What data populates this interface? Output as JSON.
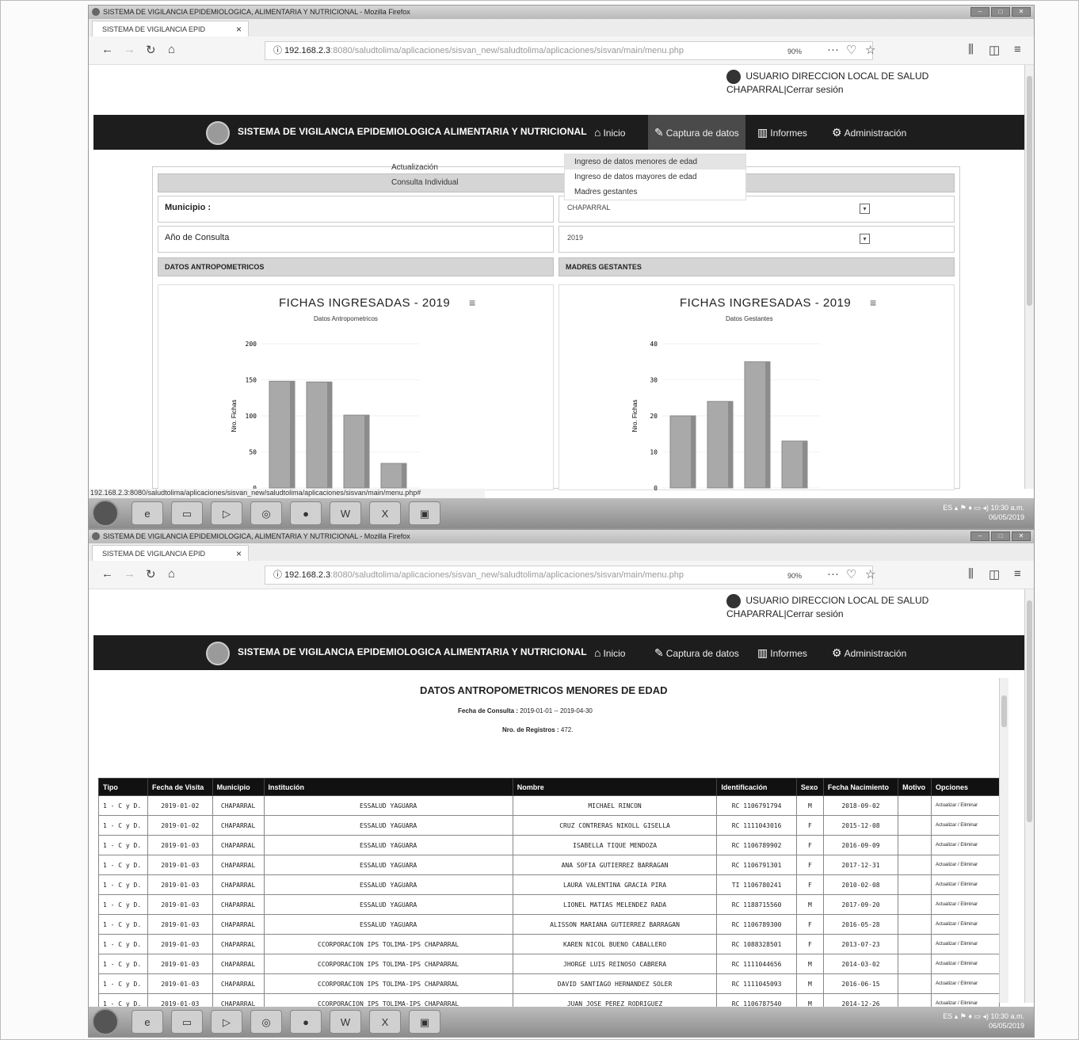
{
  "window_title": "SISTEMA DE VIGILANCIA EPIDEMIOLOGICA, ALIMENTARIA Y NUTRICIONAL - Mozilla Firefox",
  "tab_title": "SISTEMA DE VIGILANCIA EPID",
  "url_main": "192.168.2.3",
  "url_path_1": ":8080/saludtolima/aplicaciones/sisvan_new/saludtolima/aplicaciones/sisvan/main/menu.php",
  "url_path_2": ":8080/saludtolima/aplicaciones/sisvan_new/saludtolima/aplicaciones/sisvan/main/menu.php",
  "zoom": "90%",
  "status_url": "192.168.2.3:8080/saludtolima/aplicaciones/sisvan_new/saludtolima/aplicaciones/sisvan/main/menu.php#",
  "user": {
    "label": "USUARIO",
    "name": "DIRECCION LOCAL DE SALUD",
    "location": "CHAPARRAL",
    "logout": "|Cerrar sesión"
  },
  "menu": {
    "brand": "SISTEMA DE VIGILANCIA EPIDEMIOLOGICA ALIMENTARIA Y NUTRICIONAL",
    "inicio": "Inicio",
    "captura": "Captura de datos",
    "informes": "Informes",
    "admin": "Administración"
  },
  "dropdown_left": [
    "Actualización",
    "Consulta Individual"
  ],
  "dropdown_right": [
    "Ingreso de datos menores de edad",
    "Ingreso de datos mayores de edad",
    "Madres gestantes"
  ],
  "form": {
    "municipio_label": "Municipio :",
    "municipio_value": "CHAPARRAL",
    "anio_label": "Año de Consulta",
    "anio_value": "2019",
    "left_section": "DATOS ANTROPOMETRICOS",
    "right_section": "MADRES GESTANTES"
  },
  "chart_data": [
    {
      "type": "bar",
      "title": "FICHAS INGRESADAS - 2019",
      "subtitle": "Datos Antropometricos",
      "ylabel": "Nro. Fichas",
      "ylim": [
        0,
        200
      ],
      "yticks": [
        0,
        50,
        100,
        150,
        200
      ],
      "categories": [
        "",
        "",
        "",
        ""
      ],
      "values": [
        148,
        147,
        101,
        34
      ]
    },
    {
      "type": "bar",
      "title": "FICHAS INGRESADAS - 2019",
      "subtitle": "Datos Gestantes",
      "ylabel": "Nro. Fichas",
      "ylim": [
        0,
        40
      ],
      "yticks": [
        0,
        10,
        20,
        30,
        40
      ],
      "categories": [
        "",
        "",
        "",
        ""
      ],
      "values": [
        20,
        24,
        35,
        13
      ]
    }
  ],
  "report": {
    "title": "DATOS ANTROPOMETRICOS MENORES DE EDAD",
    "fecha_label": "Fecha de Consulta :",
    "fecha_value": "2019-01-01 -- 2019-04-30",
    "registros_label": "Nro. de Registros :",
    "registros_value": "472.",
    "columns": [
      "Tipo",
      "Fecha de Visita",
      "Municipio",
      "Institución",
      "Nombre",
      "Identificación",
      "Sexo",
      "Fecha Nacimiento",
      "Motivo",
      "Opciones"
    ],
    "rows": [
      [
        "1 - C y D.",
        "2019-01-02",
        "CHAPARRAL",
        "ESSALUD YAGUARA",
        "MICHAEL RINCON",
        "RC 1106791794",
        "M",
        "2018-09-02",
        ""
      ],
      [
        "1 - C y D.",
        "2019-01-02",
        "CHAPARRAL",
        "ESSALUD YAGUARA",
        "CRUZ CONTRERAS NIKOLL GISELLA",
        "RC 1111043016",
        "F",
        "2015-12-08",
        ""
      ],
      [
        "1 - C y D.",
        "2019-01-03",
        "CHAPARRAL",
        "ESSALUD YAGUARA",
        "ISABELLA TIQUE MENDOZA",
        "RC 1106789902",
        "F",
        "2016-09-09",
        ""
      ],
      [
        "1 - C y D.",
        "2019-01-03",
        "CHAPARRAL",
        "ESSALUD YAGUARA",
        "ANA SOFIA GUTIERREZ BARRAGAN",
        "RC 1106791301",
        "F",
        "2017-12-31",
        ""
      ],
      [
        "1 - C y D.",
        "2019-01-03",
        "CHAPARRAL",
        "ESSALUD YAGUARA",
        "LAURA VALENTINA GRACIA PIRA",
        "TI 1106780241",
        "F",
        "2010-02-08",
        ""
      ],
      [
        "1 - C y D.",
        "2019-01-03",
        "CHAPARRAL",
        "ESSALUD YAGUARA",
        "LIONEL MATIAS MELENDEZ RADA",
        "RC 1188715560",
        "M",
        "2017-09-20",
        ""
      ],
      [
        "1 - C y D.",
        "2019-01-03",
        "CHAPARRAL",
        "ESSALUD YAGUARA",
        "ALISSON MARIANA GUTIERREZ BARRAGAN",
        "RC 1106789300",
        "F",
        "2016-05-28",
        ""
      ],
      [
        "1 - C y D.",
        "2019-01-03",
        "CHAPARRAL",
        "CCORPORACION IPS TOLIMA-IPS CHAPARRAL",
        "KAREN NICOL BUENO CABALLERO",
        "RC 1088328501",
        "F",
        "2013-07-23",
        ""
      ],
      [
        "1 - C y D.",
        "2019-01-03",
        "CHAPARRAL",
        "CCORPORACION IPS TOLIMA-IPS CHAPARRAL",
        "JHORGE LUIS REINOSO CABRERA",
        "RC 1111044656",
        "M",
        "2014-03-02",
        ""
      ],
      [
        "1 - C y D.",
        "2019-01-03",
        "CHAPARRAL",
        "CCORPORACION IPS TOLIMA-IPS CHAPARRAL",
        "DAVID SANTIAGO HERNANDEZ SOLER",
        "RC 1111045093",
        "M",
        "2016-06-15",
        ""
      ],
      [
        "1 - C y D.",
        "2019-01-03",
        "CHAPARRAL",
        "CCORPORACION IPS TOLIMA-IPS CHAPARRAL",
        "JUAN JOSE PEREZ RODRIGUEZ",
        "RC 1106787540",
        "M",
        "2014-12-26",
        ""
      ]
    ],
    "opt_update": "Actualizar",
    "opt_sep": " / ",
    "opt_delete": "Eliminar"
  },
  "taskbar": {
    "lang": "ES",
    "time": "10:30 a.m.",
    "date": "06/05/2019"
  }
}
